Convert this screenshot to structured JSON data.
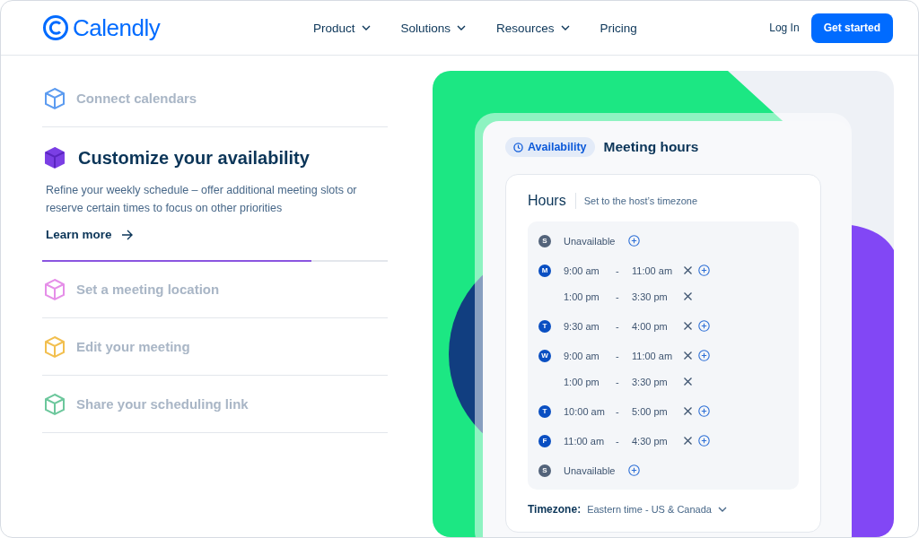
{
  "brand": {
    "name": "Calendly"
  },
  "nav": [
    {
      "label": "Product",
      "has_menu": true
    },
    {
      "label": "Solutions",
      "has_menu": true
    },
    {
      "label": "Resources",
      "has_menu": true
    },
    {
      "label": "Pricing",
      "has_menu": false
    }
  ],
  "login": "Log In",
  "cta": "Get started",
  "steps": [
    {
      "title": "Connect calendars",
      "color": "#5b9bf0",
      "expanded": false
    },
    {
      "title": "Customize your availability",
      "color": "#7b3fe4",
      "expanded": true,
      "description": "Refine your weekly schedule – offer additional meeting slots or reserve certain times to focus on other priorities",
      "link": "Learn more",
      "level": 0.78
    },
    {
      "title": "Set a meeting location",
      "color": "#e58ee8",
      "expanded": false
    },
    {
      "title": "Edit your meeting",
      "color": "#f2bf4e",
      "expanded": false
    },
    {
      "title": "Share your scheduling link",
      "color": "#6cc79c",
      "expanded": false
    }
  ],
  "preview": {
    "chip": "Availability",
    "title": "Meeting hours",
    "hours": {
      "title": "Hours",
      "subtitle": "Set to the host’s timezone",
      "days": [
        {
          "day": "S",
          "available": false,
          "status": "Unavailable"
        },
        {
          "day": "M",
          "available": true,
          "slots": [
            {
              "start": "9:00 am",
              "dash": "-",
              "end": "11:00 am"
            },
            {
              "start": "1:00 pm",
              "dash": "-",
              "end": "3:30 pm"
            }
          ]
        },
        {
          "day": "T",
          "available": true,
          "slots": [
            {
              "start": "9:30 am",
              "dash": "-",
              "end": "4:00 pm"
            }
          ]
        },
        {
          "day": "W",
          "available": true,
          "slots": [
            {
              "start": "9:00 am",
              "dash": "-",
              "end": "11:00 am"
            },
            {
              "start": "1:00 pm",
              "dash": "-",
              "end": "3:30 pm"
            }
          ]
        },
        {
          "day": "T",
          "available": true,
          "slots": [
            {
              "start": "10:00 am",
              "dash": "-",
              "end": "5:00 pm"
            }
          ]
        },
        {
          "day": "F",
          "available": true,
          "slots": [
            {
              "start": "11:00 am",
              "dash": "-",
              "end": "4:30 pm"
            }
          ]
        },
        {
          "day": "S",
          "available": false,
          "status": "Unavailable"
        }
      ]
    },
    "timezone": {
      "label": "Timezone:",
      "value": "Eastern time - US & Canada"
    }
  }
}
